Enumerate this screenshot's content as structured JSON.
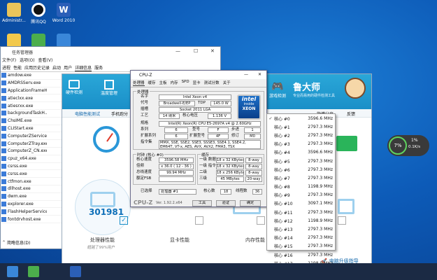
{
  "desktop": {
    "icons": [
      {
        "label": "Administr..."
      },
      {
        "label": "腾讯QQ"
      },
      {
        "label": "Word 2010"
      }
    ],
    "bottom_icon": "Repro..."
  },
  "taskmgr": {
    "title": "任务管理器",
    "menu": [
      "文件(F)",
      "选项(O)",
      "查看(V)"
    ],
    "tabs": [
      "进程",
      "性能",
      "应用历史记录",
      "启动",
      "用户",
      "详细信息",
      "服务"
    ],
    "rows": [
      [
        "amdow.exe",
        "2104"
      ],
      [
        "AMDRSServ.exe",
        "11828"
      ],
      [
        "ApplicationFrameH...",
        "11864"
      ],
      [
        "atieclxx.exe",
        "6040"
      ],
      [
        "atiesrxx.exe",
        "2640"
      ],
      [
        "backgroundTaskH...",
        "14760"
      ],
      [
        "ChsIME.exe",
        "6908"
      ],
      [
        "CLIStart.exe",
        "9840"
      ],
      [
        "ComputerZService...",
        "4544"
      ],
      [
        "ComputerZTray.exe",
        "2468"
      ],
      [
        "ComputerZ_CN.exe",
        "10900"
      ],
      [
        "cpuz_x64.exe",
        "10652"
      ],
      [
        "csrss.exe",
        "996"
      ],
      [
        "csrss.exe",
        "12436"
      ],
      [
        "ctfmon.exe",
        "11044"
      ],
      [
        "dllhost.exe",
        "7156"
      ],
      [
        "dwm.exe",
        "14944"
      ],
      [
        "explorer.exe",
        "11760"
      ],
      [
        "FlashHelperService...",
        "3248"
      ],
      [
        "fontdrvhost.exe",
        "7820"
      ]
    ],
    "footer": "简略信息(D)"
  },
  "lu": {
    "brand": "鲁大师",
    "slogan": "专业而易用的硬件检测工具",
    "tools": [
      "硬件检测",
      "温度管理"
    ],
    "nav": [
      "电脑性能测试",
      "手机跑分"
    ],
    "score": "301981",
    "score_label": "处理器性能",
    "score_sub": "超越了99%用户",
    "gpu_label": "显卡性能",
    "mem_label": "内存性能",
    "weibo": "微博分享",
    "feedback": "反馈",
    "gamebox": "游戏检测",
    "net": {
      "pct": "7%",
      "rate": "1%",
      "speed": "0.1K/s"
    },
    "upgrade": "电脑升级指导"
  },
  "cpuz": {
    "title": "CPU-Z",
    "tabs": [
      "处理器",
      "缓存",
      "主板",
      "内存",
      "SPD",
      "显卡",
      "测试分数",
      "关于"
    ],
    "proc_group": "处理器",
    "labels": {
      "name": "名字",
      "codename": "代号",
      "package": "插槽",
      "tech": "工艺",
      "spec": "规格",
      "family": "系列",
      "ext_family": "扩展系列",
      "instr": "指令集",
      "tdp": "TDP",
      "voltage": "核心电压",
      "model": "型号",
      "ext_model": "扩展型号",
      "stepping": "步进",
      "revision": "修订"
    },
    "values": {
      "name": "Intel Xeon v4",
      "codename": "Broadwell-E/EP",
      "tdp": "145.0 W",
      "package": "Socket 2011 LGA",
      "tech": "14 纳米",
      "voltage": "1.136 V",
      "spec": "Intel(R) Xeon(R) CPU E5-2697A v4 @ 2.60GHz",
      "family": "6",
      "model": "F",
      "stepping": "1",
      "ext_family": "6",
      "ext_model": "4F",
      "revision": "M0",
      "instr": "MMX, SSE, SSE2, SSE3, SSSE3, SSE4.1, SSE4.2, EM64T, VT-x, AES, AVX, AVX2, FMA3, TSX"
    },
    "clock_group": "时钟 (核心 #0)",
    "cache_group": "缓存",
    "clock": [
      [
        "核心速度",
        "3596.58 MHz"
      ],
      [
        "倍频",
        "x 36.0 ( 12 - 36 )"
      ],
      [
        "总线速度",
        "99.94 MHz"
      ],
      [
        "额定FSB",
        ""
      ]
    ],
    "cache": [
      [
        "一级 数据",
        "18 x 32 KBytes",
        "8-way"
      ],
      [
        "一级 指令",
        "18 x 32 KBytes",
        "8-way"
      ],
      [
        "二级",
        "18 x 256 KBytes",
        "8-way"
      ],
      [
        "三级",
        "45 MBytes",
        "20-way"
      ]
    ],
    "selected_label": "已选择",
    "selected": "处理器 #1",
    "cores_label": "核心数",
    "cores": "18",
    "threads_label": "线程数",
    "threads": "36",
    "brand": "CPU-Z",
    "version": "Ver. 1.92.2.x64",
    "tools": "工具",
    "validate": "验证",
    "ok": "确定",
    "intel": {
      "top": "intel",
      "mid": "inside",
      "bot": "XEON"
    }
  },
  "cores": [
    [
      "核心 #0",
      "3596.6 MHz"
    ],
    [
      "核心 #1",
      "2797.3 MHz"
    ],
    [
      "核心 #2",
      "2797.3 MHz"
    ],
    [
      "核心 #3",
      "2797.3 MHz"
    ],
    [
      "核心 #4",
      "3596.6 MHz"
    ],
    [
      "核心 #5",
      "2797.3 MHz"
    ],
    [
      "核心 #6",
      "2797.3 MHz"
    ],
    [
      "核心 #7",
      "2797.3 MHz"
    ],
    [
      "核心 #8",
      "1198.9 MHz"
    ],
    [
      "核心 #9",
      "2797.3 MHz"
    ],
    [
      "核心 #10",
      "3097.1 MHz"
    ],
    [
      "核心 #11",
      "2797.3 MHz"
    ],
    [
      "核心 #12",
      "1198.9 MHz"
    ],
    [
      "核心 #13",
      "2797.3 MHz"
    ],
    [
      "核心 #14",
      "2797.3 MHz"
    ],
    [
      "核心 #15",
      "2797.3 MHz"
    ],
    [
      "核心 #16",
      "2797.3 MHz"
    ],
    [
      "核心 #17",
      "1198.9 MHz"
    ]
  ],
  "colors": {
    "accent": "#1a8fc8",
    "score": "#0e6fb8"
  }
}
